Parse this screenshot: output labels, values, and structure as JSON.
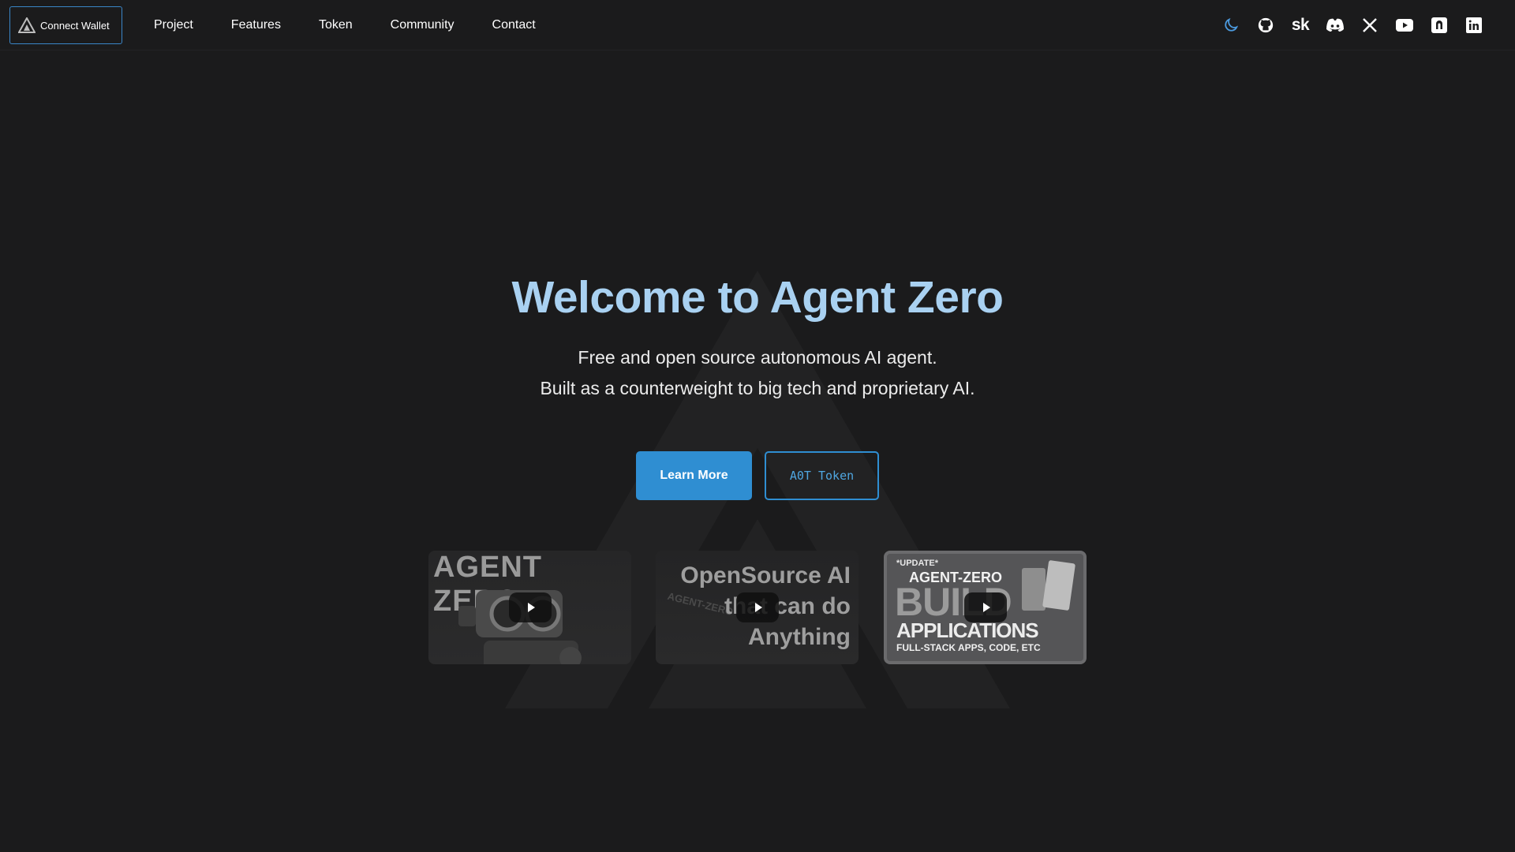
{
  "header": {
    "wallet_label": "Connect Wallet",
    "nav": [
      "Project",
      "Features",
      "Token",
      "Community",
      "Contact"
    ],
    "social_icons": [
      "moon-icon",
      "github-icon",
      "skool-icon",
      "discord-icon",
      "x-icon",
      "youtube-icon",
      "ko-fi-icon",
      "linkedin-icon"
    ],
    "skool_text": "sk"
  },
  "hero": {
    "title": "Welcome to Agent Zero",
    "subtitle_line1": "Free and open source autonomous AI agent.",
    "subtitle_line2": "Built as a counterweight to big tech and proprietary AI.",
    "primary_button": "Learn More",
    "secondary_button": "A0T Token"
  },
  "videos": [
    {
      "text": "AGENT ZERO"
    },
    {
      "text_line1": "OpenSource AI",
      "text_line2": "that can do",
      "text_line3": "Anything",
      "watermark": "AGENT-ZERO"
    },
    {
      "tag": "*UPDATE*",
      "brand": "AGENT-ZERO",
      "headline1": "BUILD",
      "headline2": "APPLICATIONS",
      "caption": "FULL-STACK APPS, CODE, ETC"
    }
  ],
  "colors": {
    "background": "#1b1b1c",
    "title": "#a9d1f1",
    "accent": "#2f8ed2"
  }
}
